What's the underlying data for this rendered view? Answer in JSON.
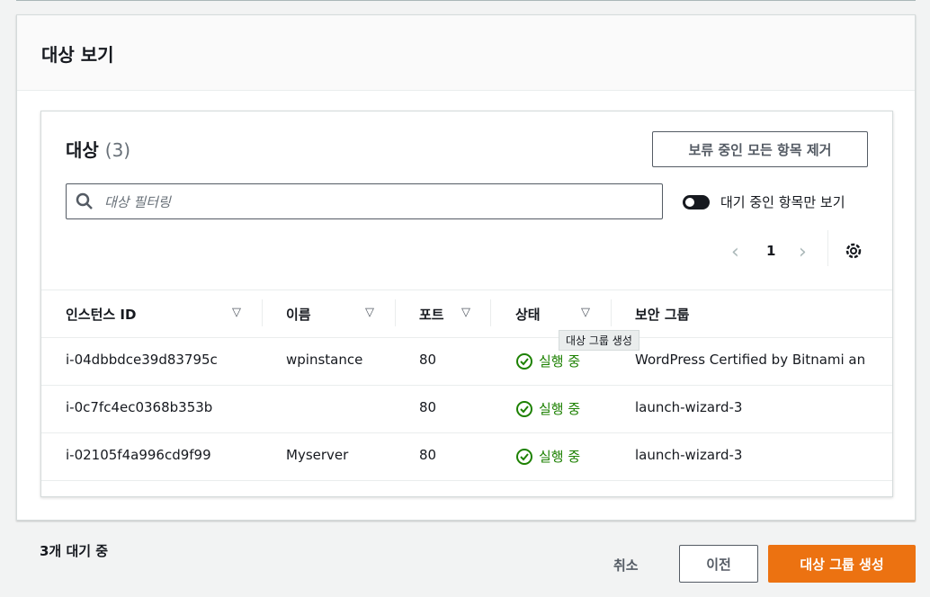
{
  "panel": {
    "title": "대상 보기"
  },
  "card": {
    "title": "대상",
    "count": "(3)",
    "remove_all_label": "보류 중인 모든 항목 제거",
    "search_placeholder": "대상 필터링",
    "toggle_label": "대기 중인 항목만 보기",
    "page": "1",
    "tooltip": "대상 그룹 생성"
  },
  "table": {
    "headers": [
      "인스턴스 ID",
      "이름",
      "포트",
      "상태",
      "보안 그룹"
    ],
    "rows": [
      {
        "id": "i-04dbbdce39d83795c",
        "name": "wpinstance",
        "port": "80",
        "status": "실행 중",
        "sg": "WordPress Certified by Bitnami an"
      },
      {
        "id": "i-0c7fc4ec0368b353b",
        "name": "",
        "port": "80",
        "status": "실행 중",
        "sg": "launch-wizard-3"
      },
      {
        "id": "i-02105f4a996cd9f99",
        "name": "Myserver",
        "port": "80",
        "status": "실행 중",
        "sg": "launch-wizard-3"
      }
    ]
  },
  "footer": {
    "pending": "3개 대기 중",
    "cancel_label": "취소",
    "previous_label": "이전",
    "create_label": "대상 그룹 생성"
  },
  "colors": {
    "primary": "#ec7211",
    "success": "#1d8102"
  }
}
